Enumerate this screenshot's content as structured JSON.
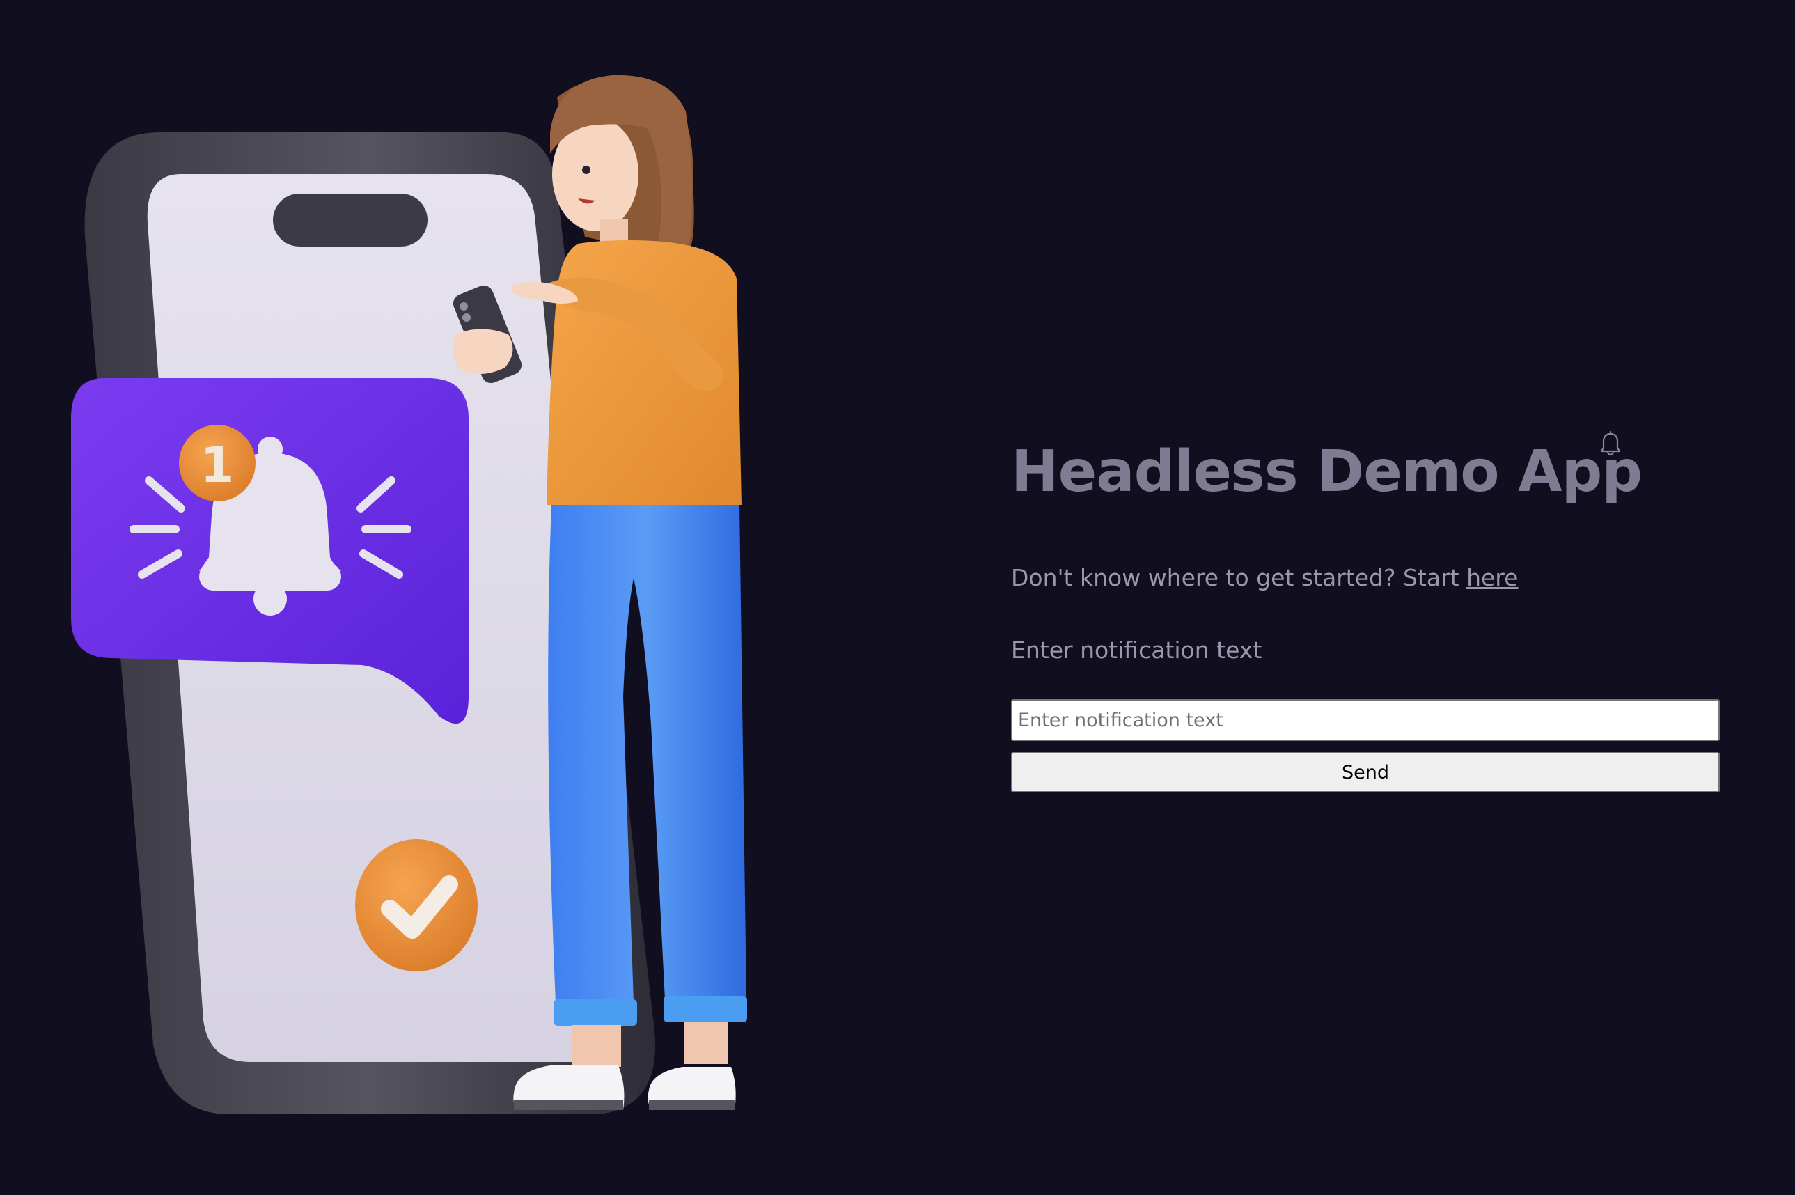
{
  "header": {
    "title": "Headless Demo App",
    "notification_icon": "bell-icon"
  },
  "intro": {
    "prefix": "Don't know where to get started? Start ",
    "link_label": "here"
  },
  "form": {
    "label": "Enter notification text",
    "input_placeholder": "Enter notification text",
    "input_value": "",
    "send_label": "Send"
  },
  "illustration": {
    "badge_count": "1",
    "icons": [
      "bell-icon",
      "check-icon"
    ]
  },
  "colors": {
    "background": "#110e20",
    "title": "#7e7b93",
    "text": "#9b98ac",
    "accent_purple": "#6a2be8",
    "accent_orange": "#e88b34"
  }
}
